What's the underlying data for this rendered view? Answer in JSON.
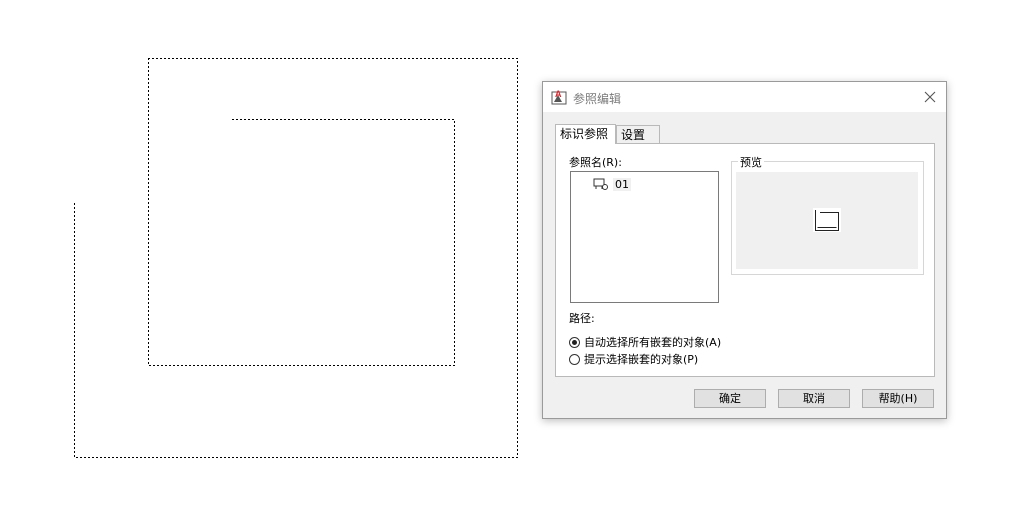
{
  "dialog": {
    "title": "参照编辑",
    "tabs": [
      {
        "label": "标识参照",
        "active": true
      },
      {
        "label": "设置",
        "active": false
      }
    ],
    "reference_name_label": "参照名(R):",
    "reference_items": [
      {
        "label": "01",
        "icon": "block-reference-icon"
      }
    ],
    "preview_label": "预览",
    "path_label": "路径:",
    "options": [
      {
        "label": "自动选择所有嵌套的对象(A)",
        "checked": true
      },
      {
        "label": "提示选择嵌套的对象(P)",
        "checked": false
      }
    ],
    "buttons": {
      "ok": "确定",
      "cancel": "取消",
      "help": "帮助(H)"
    }
  },
  "colors": {
    "dialog_bg": "#f0f0f0",
    "title_text": "#7a7a7a",
    "dashed_line": "#000000",
    "icon_red": "#d9262c"
  }
}
